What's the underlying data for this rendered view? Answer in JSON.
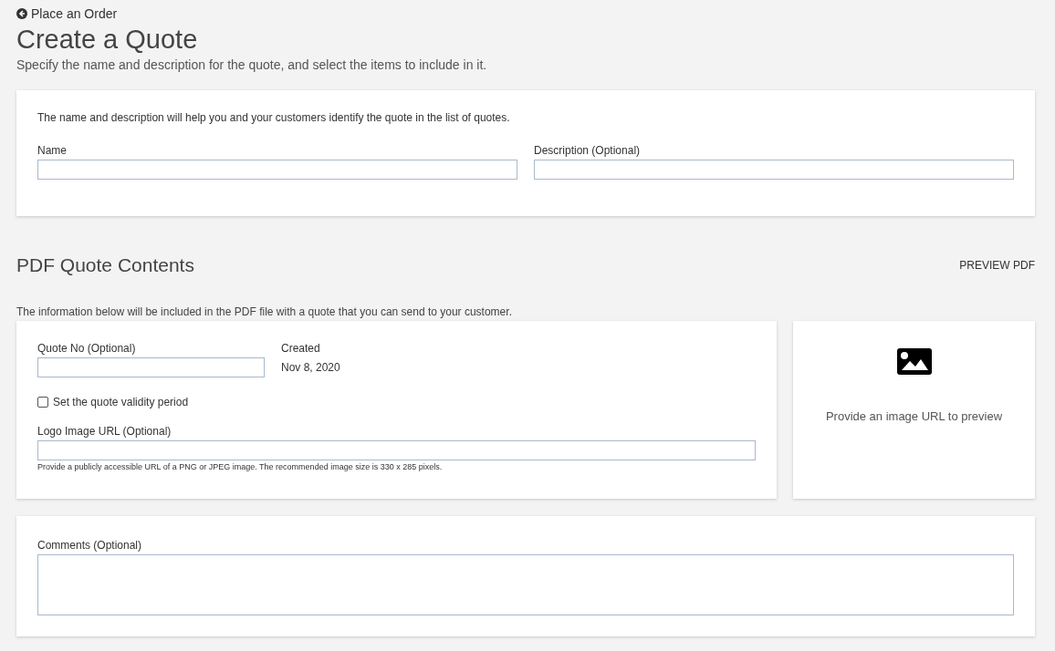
{
  "back_link": "Place an Order",
  "title": "Create a Quote",
  "subtitle": "Specify the name and description for the quote, and select the items to include in it.",
  "details_card": {
    "intro": "The name and description will help you and your customers identify the quote in the list of quotes.",
    "fields": [
      {
        "label": "Name"
      },
      {
        "label": "Description (Optional)"
      }
    ]
  },
  "pdf_section": {
    "heading": "PDF Quote Contents",
    "preview_button": "PREVIEW PDF",
    "intro": "The information below will be included in the PDF file with a quote that you can send to your customer.",
    "quote_no": {
      "label": "Quote No (Optional)"
    },
    "created": {
      "label": "Created",
      "value": "Nov 8, 2020"
    },
    "validity_checkbox": {
      "label": "Set the quote validity period",
      "checked": false
    },
    "logo_url": {
      "label": "Logo Image URL (Optional)",
      "hint": "Provide a publicly accessible URL of a PNG or JPEG image. The recommended image size is 330 x 285 pixels."
    },
    "logo_preview": {
      "text": "Provide an image URL to preview"
    },
    "comments": {
      "label": "Comments (Optional)"
    }
  }
}
